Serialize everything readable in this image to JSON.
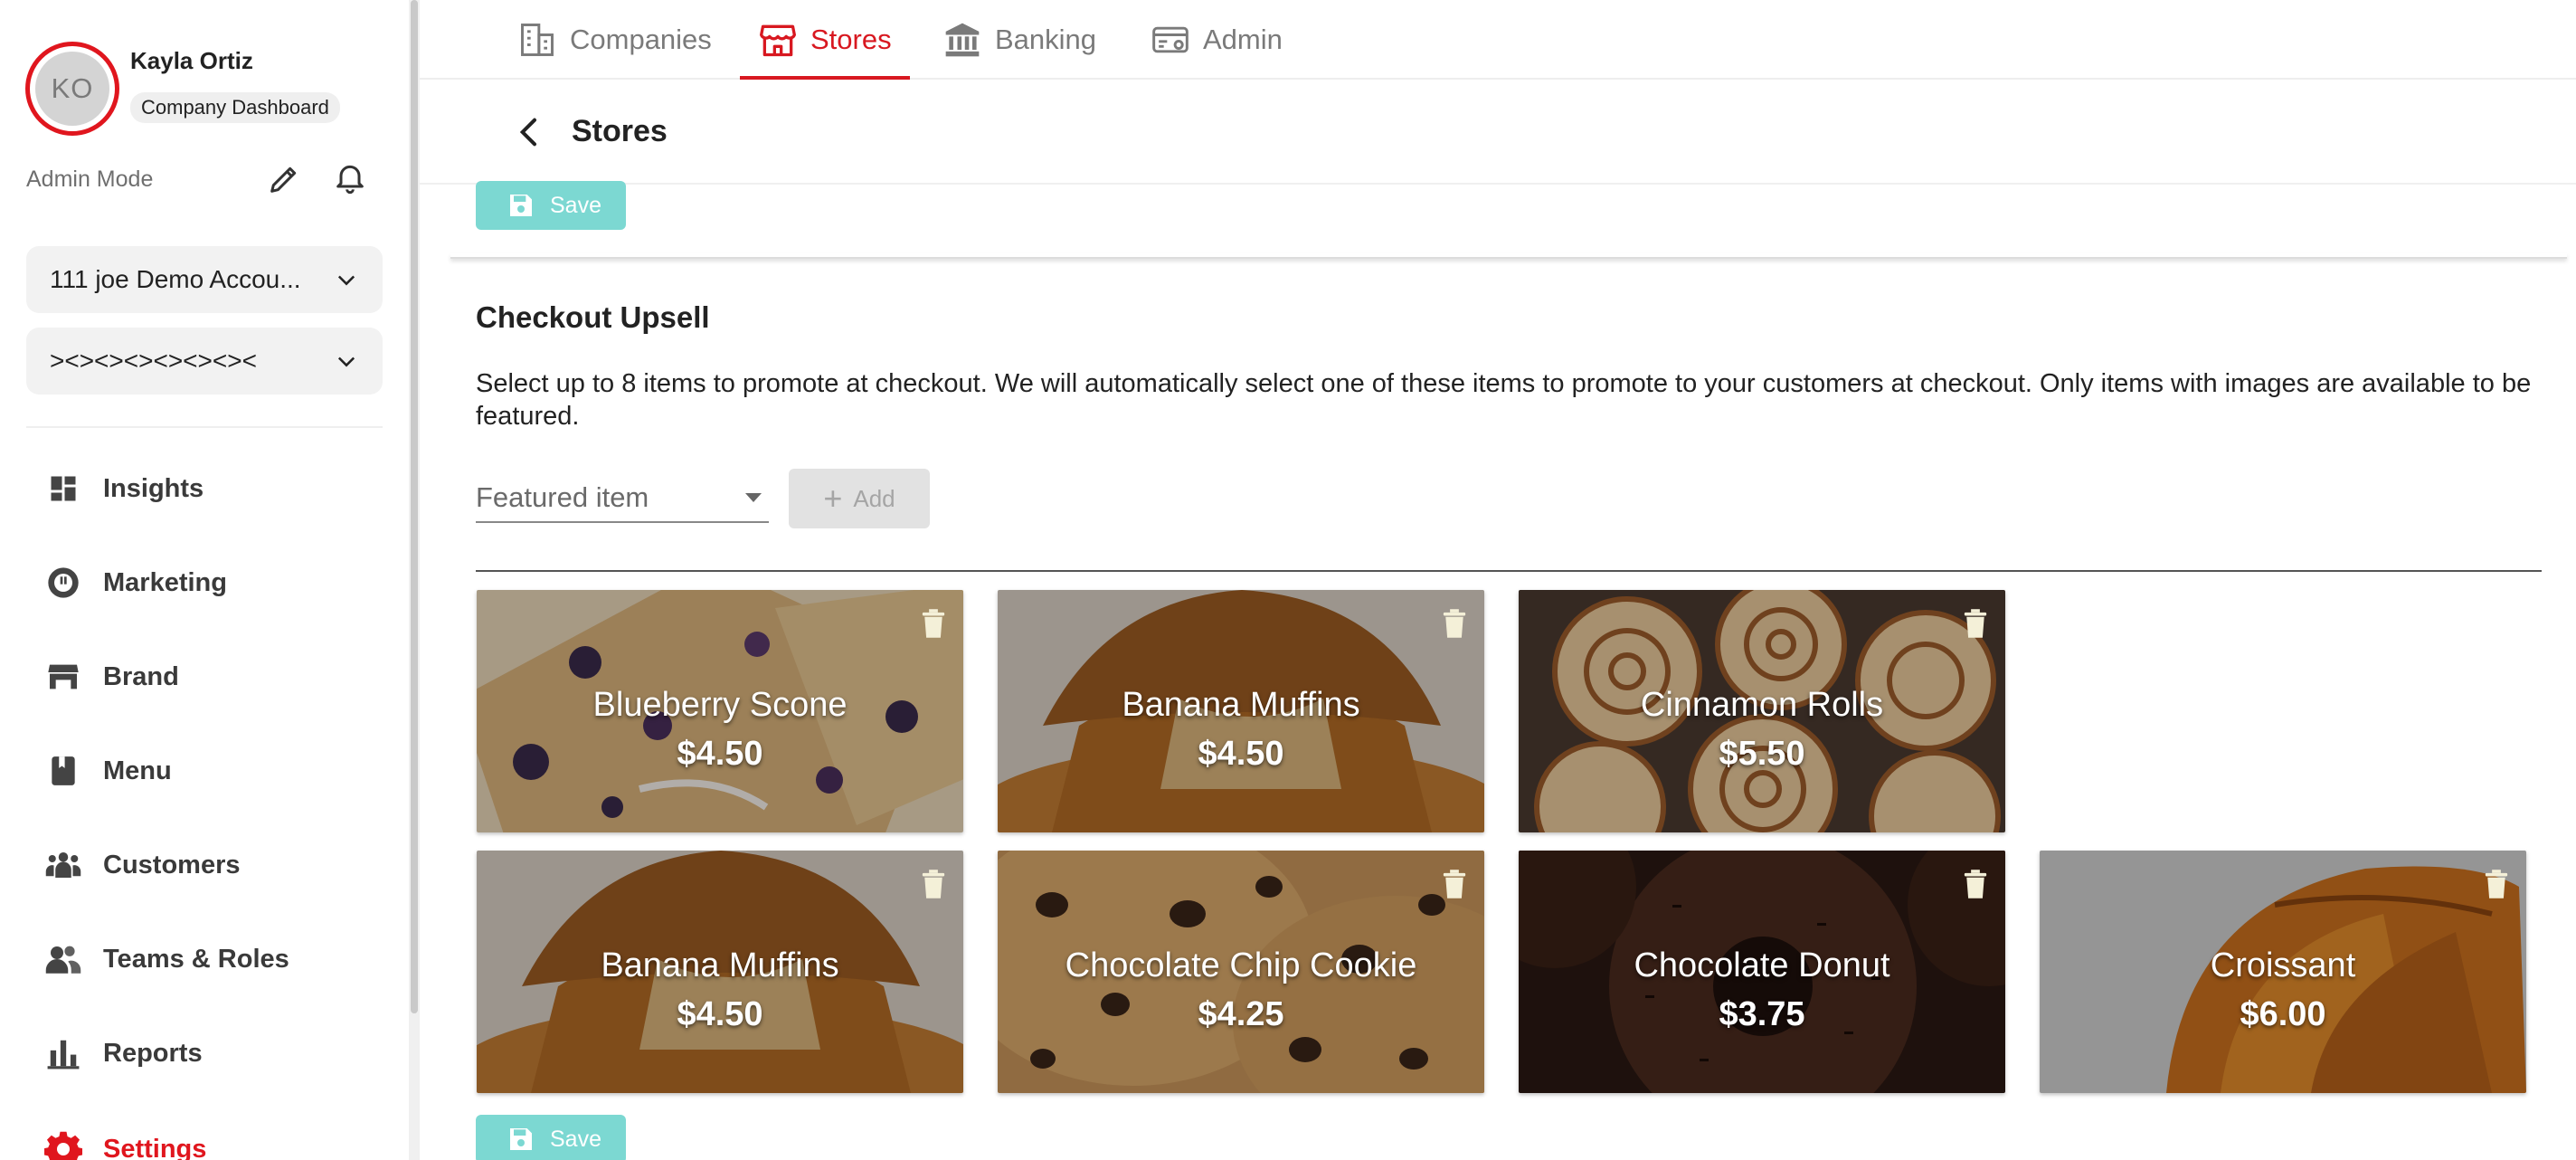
{
  "user": {
    "initials": "KO",
    "name": "Kayla Ortiz",
    "role": "Company Dashboard"
  },
  "admin_mode_label": "Admin Mode",
  "account_select": {
    "value": "111 joe Demo Accou..."
  },
  "store_select": {
    "value": "><><><><><><><"
  },
  "sidebar": {
    "items": [
      {
        "label": "Insights",
        "icon": "dashboard-icon"
      },
      {
        "label": "Marketing",
        "icon": "marketing-icon"
      },
      {
        "label": "Brand",
        "icon": "storefront-icon"
      },
      {
        "label": "Menu",
        "icon": "book-icon"
      },
      {
        "label": "Customers",
        "icon": "group-icon"
      },
      {
        "label": "Teams & Roles",
        "icon": "team-icon"
      },
      {
        "label": "Reports",
        "icon": "bar-chart-icon"
      },
      {
        "label": "Settings",
        "icon": "gear-icon",
        "active": true
      }
    ]
  },
  "top_tabs": [
    {
      "label": "Companies",
      "icon": "building-icon"
    },
    {
      "label": "Stores",
      "icon": "store-icon",
      "active": true
    },
    {
      "label": "Banking",
      "icon": "bank-icon"
    },
    {
      "label": "Admin",
      "icon": "admin-card-icon"
    }
  ],
  "page": {
    "title": "Stores"
  },
  "save_label": "Save",
  "upsell": {
    "title": "Checkout Upsell",
    "description": "Select up to 8 items to promote at checkout. We will automatically select one of these items to promote to your customers at checkout. Only items with images are available to be featured.",
    "featured_placeholder": "Featured item",
    "add_label": "Add",
    "items": [
      {
        "name": "Blueberry Scone",
        "price": "$4.50"
      },
      {
        "name": "Banana Muffins",
        "price": "$4.50"
      },
      {
        "name": "Cinnamon Rolls",
        "price": "$5.50"
      },
      {
        "name": "Banana Muffins",
        "price": "$4.50"
      },
      {
        "name": "Chocolate Chip Cookie",
        "price": "$4.25"
      },
      {
        "name": "Chocolate Donut",
        "price": "$3.75"
      },
      {
        "name": "Croissant",
        "price": "$6.00"
      }
    ]
  },
  "colors": {
    "brand_red": "#d81820",
    "save_teal": "#7cd8d2"
  }
}
